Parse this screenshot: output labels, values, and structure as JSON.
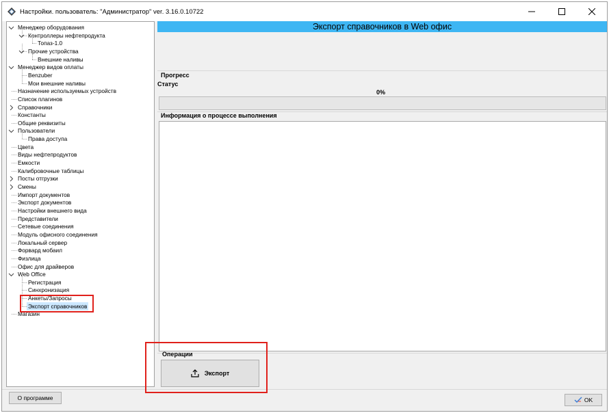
{
  "window": {
    "title": "Настройки. пользователь: \"Администратор\" ver. 3.16.0.10722",
    "minimize_label": "minimize",
    "maximize_label": "maximize",
    "close_label": "close"
  },
  "tree": {
    "items": [
      {
        "label": "Менеджер оборудования",
        "level": 0,
        "expander": "expanded"
      },
      {
        "label": "Контроллеры нефтепродукта",
        "level": 1,
        "expander": "expanded"
      },
      {
        "label": "Топаз-1.0",
        "level": 2,
        "expander": "none"
      },
      {
        "label": "Прочие устройства",
        "level": 1,
        "expander": "expanded"
      },
      {
        "label": "Внешние наливы",
        "level": 2,
        "expander": "none"
      },
      {
        "label": "Менеджер видов оплаты",
        "level": 0,
        "expander": "expanded"
      },
      {
        "label": "Benzuber",
        "level": 1,
        "expander": "none"
      },
      {
        "label": "Мои внешние наливы",
        "level": 1,
        "expander": "none"
      },
      {
        "label": "Назначение используемых устройств",
        "level": 0,
        "expander": "none"
      },
      {
        "label": "Список плагинов",
        "level": 0,
        "expander": "none"
      },
      {
        "label": "Справочники",
        "level": 0,
        "expander": "collapsed"
      },
      {
        "label": "Константы",
        "level": 0,
        "expander": "none"
      },
      {
        "label": "Общие реквизиты",
        "level": 0,
        "expander": "none"
      },
      {
        "label": "Пользователи",
        "level": 0,
        "expander": "expanded"
      },
      {
        "label": "Права доступа",
        "level": 1,
        "expander": "none"
      },
      {
        "label": "Цвета",
        "level": 0,
        "expander": "none"
      },
      {
        "label": "Виды нефтепродуктов",
        "level": 0,
        "expander": "none"
      },
      {
        "label": "Емкости",
        "level": 0,
        "expander": "none"
      },
      {
        "label": "Калибровочные таблицы",
        "level": 0,
        "expander": "none"
      },
      {
        "label": "Посты отгрузки",
        "level": 0,
        "expander": "collapsed"
      },
      {
        "label": "Смены",
        "level": 0,
        "expander": "collapsed"
      },
      {
        "label": "Импорт документов",
        "level": 0,
        "expander": "none"
      },
      {
        "label": "Экспорт документов",
        "level": 0,
        "expander": "none"
      },
      {
        "label": "Настройки внешнего вида",
        "level": 0,
        "expander": "none"
      },
      {
        "label": "Представители",
        "level": 0,
        "expander": "none"
      },
      {
        "label": "Сетевые соединения",
        "level": 0,
        "expander": "none"
      },
      {
        "label": "Модуль офисного соединения",
        "level": 0,
        "expander": "none"
      },
      {
        "label": "Локальный сервер",
        "level": 0,
        "expander": "none"
      },
      {
        "label": "Форвард мобаил",
        "level": 0,
        "expander": "none"
      },
      {
        "label": "Физлица",
        "level": 0,
        "expander": "none"
      },
      {
        "label": "Офис для драйверов",
        "level": 0,
        "expander": "none"
      },
      {
        "label": "Web Office",
        "level": 0,
        "expander": "expanded"
      },
      {
        "label": "Регистрация",
        "level": 1,
        "expander": "none"
      },
      {
        "label": "Синхронизация",
        "level": 1,
        "expander": "none"
      },
      {
        "label": "Анкеты/Запросы",
        "level": 1,
        "expander": "none"
      },
      {
        "label": "Экспорт справочников",
        "level": 1,
        "expander": "none",
        "selected": true
      },
      {
        "label": "Магазин",
        "level": 0,
        "expander": "none"
      }
    ]
  },
  "main": {
    "header": "Экспорт справочников в Web офис",
    "progress_group": "Прогресс",
    "status_label": "Статус",
    "progress_value": 0,
    "progress_text": "0%",
    "info_group": "Информация о процессе выполнения",
    "operations_group": "Операции",
    "export_button": "Экспорт",
    "export_icon": "upload-icon"
  },
  "footer": {
    "about_button": "О программе",
    "ok_button": "OK",
    "ok_icon": "ok-check-icon"
  },
  "colors": {
    "header_bg": "#3eb6f3",
    "selection_bg": "#cce8ff",
    "annotation_red": "#e0201b"
  }
}
